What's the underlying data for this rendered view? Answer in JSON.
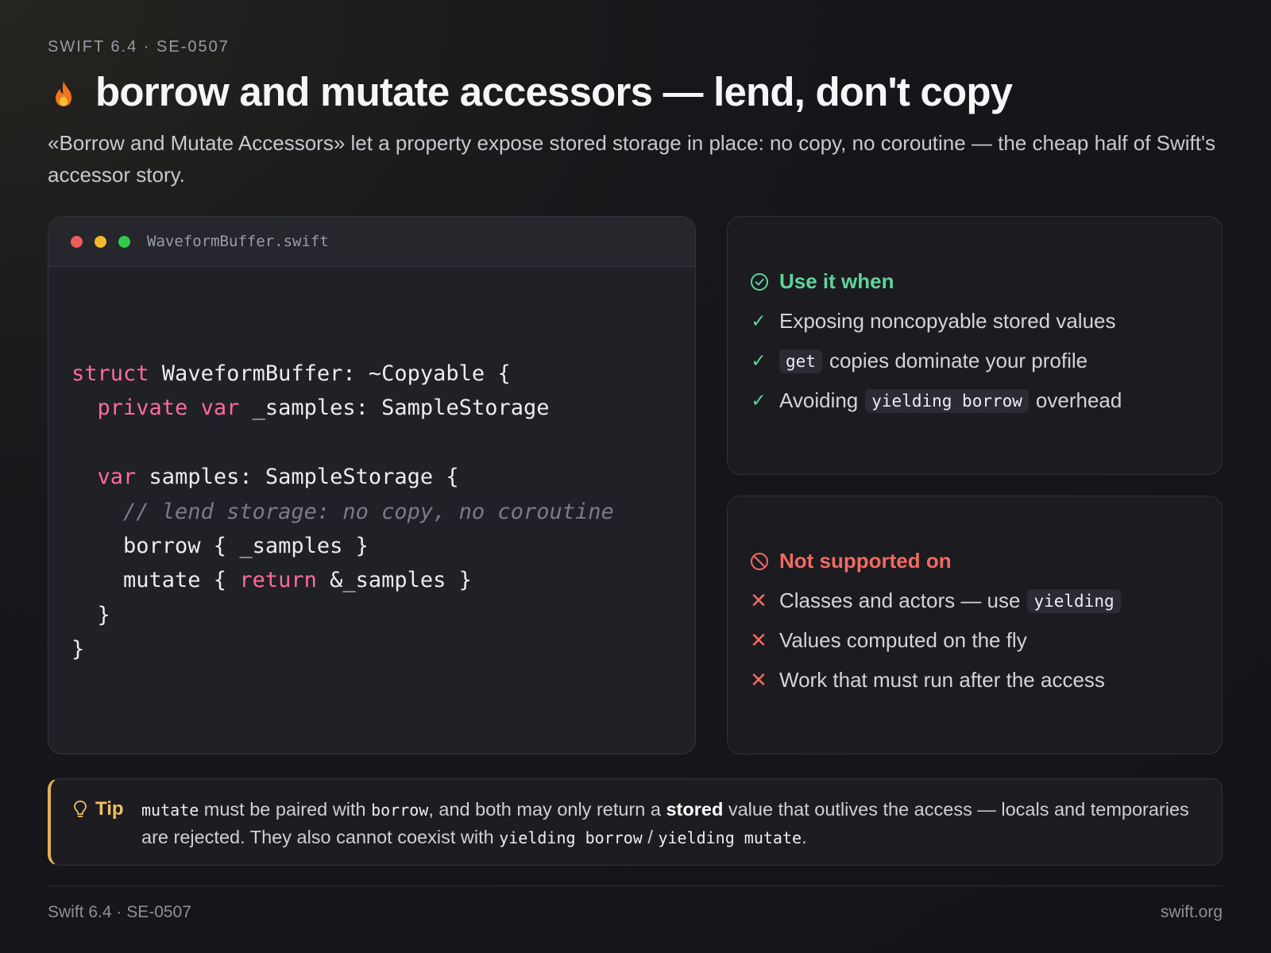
{
  "header": {
    "eyebrow": "SWIFT 6.4 · SE-0507",
    "title": "borrow and mutate accessors — lend, don't copy",
    "subtitle": "«Borrow and Mutate Accessors» let a property expose stored storage in place: no copy, no coroutine — the cheap half of Swift's accessor story.",
    "title_icon": "flame-icon"
  },
  "code_window": {
    "filename": "WaveformBuffer.swift",
    "lines": {
      "l1_kw": "struct",
      "l1_rest": " WaveformBuffer: ~Copyable {",
      "l2_indent": "  ",
      "l2_kw1": "private",
      "l2_sp": " ",
      "l2_kw2": "var",
      "l2_rest": " _samples: SampleStorage",
      "l4_indent": "  ",
      "l4_kw": "var",
      "l4_rest": " samples: SampleStorage {",
      "l5_indent": "    ",
      "l5_comment": "// lend storage: no copy, no coroutine",
      "l6": "    borrow { _samples }",
      "l7_pre": "    mutate { ",
      "l7_kw": "return",
      "l7_rest": " &_samples }",
      "l8": "  }",
      "l9": "}"
    }
  },
  "use_panel": {
    "heading": "Use it when",
    "item1": "Exposing noncopyable stored values",
    "item2_code": "get",
    "item2_text": "copies dominate your profile",
    "item3_pre": "Avoiding",
    "item3_code": "yielding borrow",
    "item3_post": "overhead",
    "check_glyph": "✓"
  },
  "not_panel": {
    "heading": "Not supported on",
    "item1_pre": "Classes and actors — use",
    "item1_code": "yielding",
    "item2": "Values computed on the fly",
    "item3": "Work that must run after the access",
    "cross_glyph": "✕"
  },
  "tip": {
    "label": "Tip",
    "c1": "mutate",
    "t1": " must be paired with ",
    "c2": "borrow",
    "t2": ", and both may only return a ",
    "strong": "stored",
    "t3": " value that outlives the access — locals and temporaries are rejected. They also cannot coexist with ",
    "c3": "yielding borrow",
    "t4": " / ",
    "c4": "yielding mutate",
    "t5": "."
  },
  "footer": {
    "left": "Swift 6.4 · SE-0507",
    "right": "swift.org"
  },
  "colors": {
    "accent_green": "#5fd49a",
    "accent_red": "#f06a62",
    "tip_gold": "#f0c15a",
    "keyword_pink": "#ff6b9a"
  }
}
